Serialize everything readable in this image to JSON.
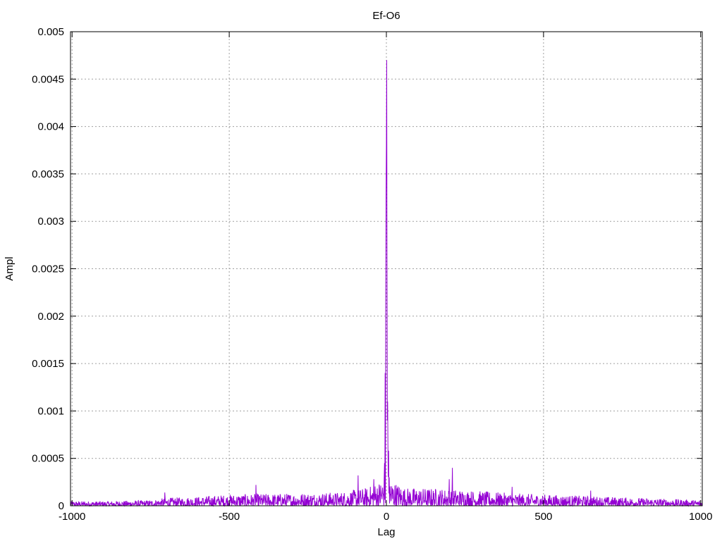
{
  "chart_data": {
    "type": "line",
    "title": "Ef-O6",
    "xlabel": "Lag",
    "ylabel": "Ampl",
    "xlim": [
      -1000,
      1000
    ],
    "ylim": [
      0,
      0.005
    ],
    "grid": true,
    "legend": "none",
    "x_ticks": [
      {
        "value": -1000,
        "label": "-1000"
      },
      {
        "value": -500,
        "label": "-500"
      },
      {
        "value": 0,
        "label": "0"
      },
      {
        "value": 500,
        "label": "500"
      },
      {
        "value": 1000,
        "label": "1000"
      }
    ],
    "y_ticks": [
      {
        "value": 0,
        "label": "0"
      },
      {
        "value": 0.0005,
        "label": "0.0005"
      },
      {
        "value": 0.001,
        "label": "0.001"
      },
      {
        "value": 0.0015,
        "label": "0.0015"
      },
      {
        "value": 0.002,
        "label": "0.002"
      },
      {
        "value": 0.0025,
        "label": "0.0025"
      },
      {
        "value": 0.003,
        "label": "0.003"
      },
      {
        "value": 0.0035,
        "label": "0.0035"
      },
      {
        "value": 0.004,
        "label": "0.004"
      },
      {
        "value": 0.0045,
        "label": "0.0045"
      },
      {
        "value": 0.005,
        "label": "0.005"
      }
    ],
    "series": [
      {
        "color": "#9400d3",
        "x_range": [
          -1005,
          1005
        ],
        "noise_envelope": [
          [
            -1005,
            4e-05
          ],
          [
            -900,
            4e-05
          ],
          [
            -750,
            5e-05
          ],
          [
            -700,
            7e-05
          ],
          [
            -600,
            8e-05
          ],
          [
            -500,
            0.0001
          ],
          [
            -300,
            0.00011
          ],
          [
            -150,
            0.00012
          ],
          [
            -60,
            0.00016
          ],
          [
            -20,
            0.00022
          ],
          [
            0,
            0.0003
          ],
          [
            20,
            0.00022
          ],
          [
            60,
            0.00016
          ],
          [
            200,
            0.00015
          ],
          [
            400,
            0.00011
          ],
          [
            600,
            9e-05
          ],
          [
            800,
            7e-05
          ],
          [
            1005,
            5e-05
          ]
        ],
        "peaks": [
          {
            "x": -6,
            "y": 0.00045
          },
          {
            "x": -4,
            "y": 0.0014
          },
          {
            "x": -2,
            "y": 0.0023
          },
          {
            "x": -1,
            "y": 0.0033
          },
          {
            "x": 0,
            "y": 0.0038
          },
          {
            "x": 1,
            "y": 0.0047
          },
          {
            "x": 2,
            "y": 0.0026
          },
          {
            "x": 3,
            "y": 0.0009
          },
          {
            "x": 4,
            "y": 0.0011
          },
          {
            "x": 5,
            "y": 0.0006
          },
          {
            "x": 7,
            "y": 0.00058
          },
          {
            "x": 9,
            "y": 0.0003
          },
          {
            "x": -90,
            "y": 0.00032
          },
          {
            "x": -40,
            "y": 0.00028
          },
          {
            "x": -415,
            "y": 0.00022
          },
          {
            "x": -705,
            "y": 0.00014
          },
          {
            "x": 200,
            "y": 0.00028
          },
          {
            "x": 210,
            "y": 0.0004
          },
          {
            "x": 400,
            "y": 0.0002
          },
          {
            "x": 650,
            "y": 0.00016
          }
        ]
      }
    ]
  }
}
